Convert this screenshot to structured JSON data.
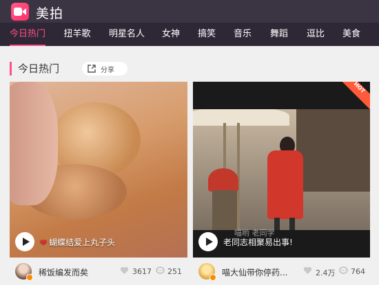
{
  "app": {
    "name": "美拍"
  },
  "nav": {
    "items": [
      {
        "label": "今日热门",
        "active": true
      },
      {
        "label": "扭羊歌"
      },
      {
        "label": "明星名人"
      },
      {
        "label": "女神"
      },
      {
        "label": "搞笑"
      },
      {
        "label": "音乐"
      },
      {
        "label": "舞蹈"
      },
      {
        "label": "逗比"
      },
      {
        "label": "美食"
      }
    ]
  },
  "section": {
    "title": "今日热门",
    "share_label": "分享"
  },
  "videos": [
    {
      "caption": "蝴蝶结爱上丸子头",
      "author": "稀饭编发而矣",
      "likes": "3617",
      "comments": "251",
      "badge": ""
    },
    {
      "caption": "老同志相聚易出事!",
      "author": "喵大仙带你停药...",
      "likes": "2.4万",
      "comments": "764",
      "badge": "HOT",
      "watermark": "喵哟  老同学"
    }
  ],
  "colors": {
    "accent": "#ff4f86",
    "topbar": "#3b3443",
    "navbar": "#2e2836",
    "hot": "#ff5b3a"
  },
  "icons": {
    "logo": "video-camera-icon",
    "share": "share-icon",
    "play": "play-icon",
    "like": "heart-icon",
    "comment": "comment-icon",
    "caption_heart": "red-heart-icon"
  }
}
